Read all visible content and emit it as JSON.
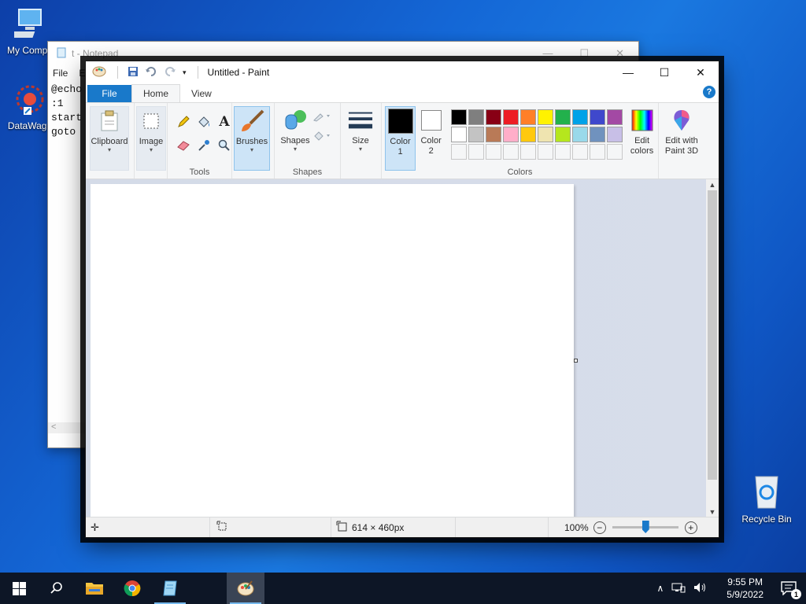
{
  "desktop": {
    "icons": [
      {
        "label": "My Compu"
      },
      {
        "label": "DataWago"
      },
      {
        "label": "Recycle Bin"
      }
    ]
  },
  "notepad": {
    "title": "t - Notepad",
    "menu": [
      "File",
      "E"
    ],
    "lines": [
      "@echo",
      ":1",
      "start",
      "goto"
    ],
    "scroll_left": "<"
  },
  "paint": {
    "title": "Untitled - Paint",
    "tabs": {
      "file": "File",
      "home": "Home",
      "view": "View"
    },
    "help": "?",
    "ribbon": {
      "clipboard": "Clipboard",
      "image": "Image",
      "tools_group": "Tools",
      "brushes": "Brushes",
      "shapes_btn": "Shapes",
      "shapes_group": "Shapes",
      "size": "Size",
      "color1": "Color 1",
      "color2": "Color 2",
      "colors_group": "Colors",
      "edit_colors": "Edit colors",
      "edit_paint3d": "Edit with Paint 3D"
    },
    "palette_row1": [
      "#000000",
      "#7f7f7f",
      "#880015",
      "#ed1c24",
      "#ff7f27",
      "#fff200",
      "#22b14c",
      "#00a2e8",
      "#3f48cc",
      "#a349a4"
    ],
    "palette_row2": [
      "#ffffff",
      "#c3c3c3",
      "#b97a57",
      "#ffaec9",
      "#ffc90e",
      "#efe4b0",
      "#b5e61d",
      "#99d9ea",
      "#7092be",
      "#c8bfe7"
    ],
    "palette_row3_empty": 10,
    "color1_value": "#000000",
    "color2_value": "#ffffff",
    "status": {
      "dimensions": "614 × 460px",
      "zoom": "100%"
    }
  },
  "taskbar": {
    "time": "9:55 PM",
    "date": "5/9/2022",
    "notifications": "1"
  },
  "colors": {
    "accent": "#1979ca",
    "taskbar": "#0d1626"
  }
}
